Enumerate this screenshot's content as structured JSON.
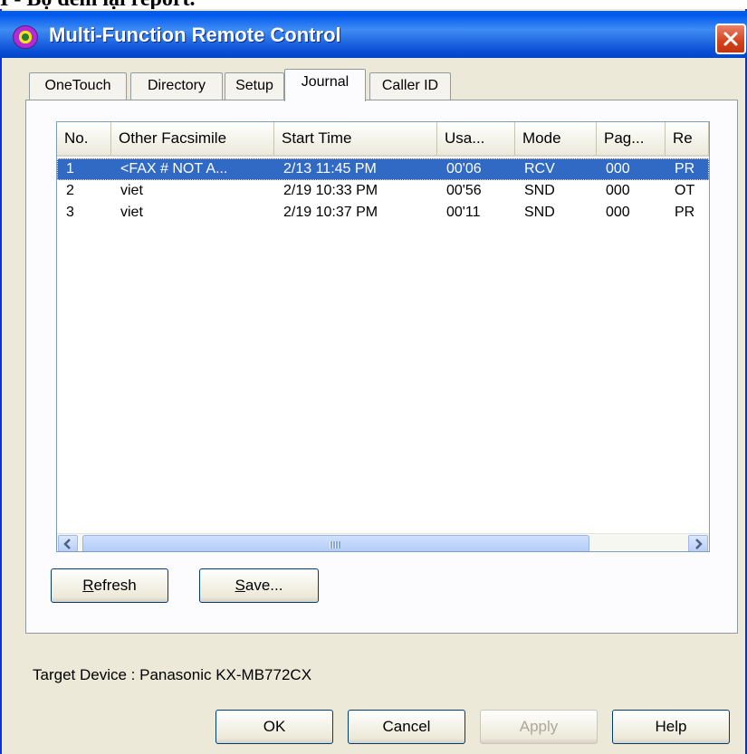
{
  "doc": {
    "heading": "I - Bộ đêm lại report."
  },
  "window": {
    "title": "Multi-Function Remote Control",
    "close_icon": "close-icon",
    "app_icon": "multifunction-app-icon"
  },
  "tabs": [
    {
      "label": "OneTouch"
    },
    {
      "label": "Directory"
    },
    {
      "label": "Setup"
    },
    {
      "label": "Journal",
      "active": true
    },
    {
      "label": "Caller ID"
    }
  ],
  "journal": {
    "columns": [
      "No.",
      "Other Facsimile",
      "Start Time",
      "Usa...",
      "Mode",
      "Pag...",
      "Re"
    ],
    "rows": [
      [
        "1",
        "<FAX # NOT A...",
        "2/13 11:45 PM",
        "00'06",
        "RCV",
        "000",
        "PR"
      ],
      [
        "2",
        "viet",
        "2/19 10:33 PM",
        "00'56",
        "SND",
        "000",
        "OT"
      ],
      [
        "3",
        "viet",
        "2/19 10:37 PM",
        "00'11",
        "SND",
        "000",
        "PR"
      ]
    ],
    "selected_row": 1
  },
  "buttons": {
    "refresh": {
      "prefix": "",
      "accel": "R",
      "rest": "efresh"
    },
    "save": {
      "prefix": "",
      "accel": "S",
      "rest": "ave..."
    },
    "ok": "OK",
    "cancel": "Cancel",
    "apply": "Apply",
    "help": "Help"
  },
  "footer": {
    "target_device": "Target Device : Panasonic KX-MB772CX"
  },
  "colors": {
    "titlebar": "#0a5ede",
    "selection": "#316ac5",
    "close": "#d2421c",
    "window_bg": "#ece9d8"
  }
}
